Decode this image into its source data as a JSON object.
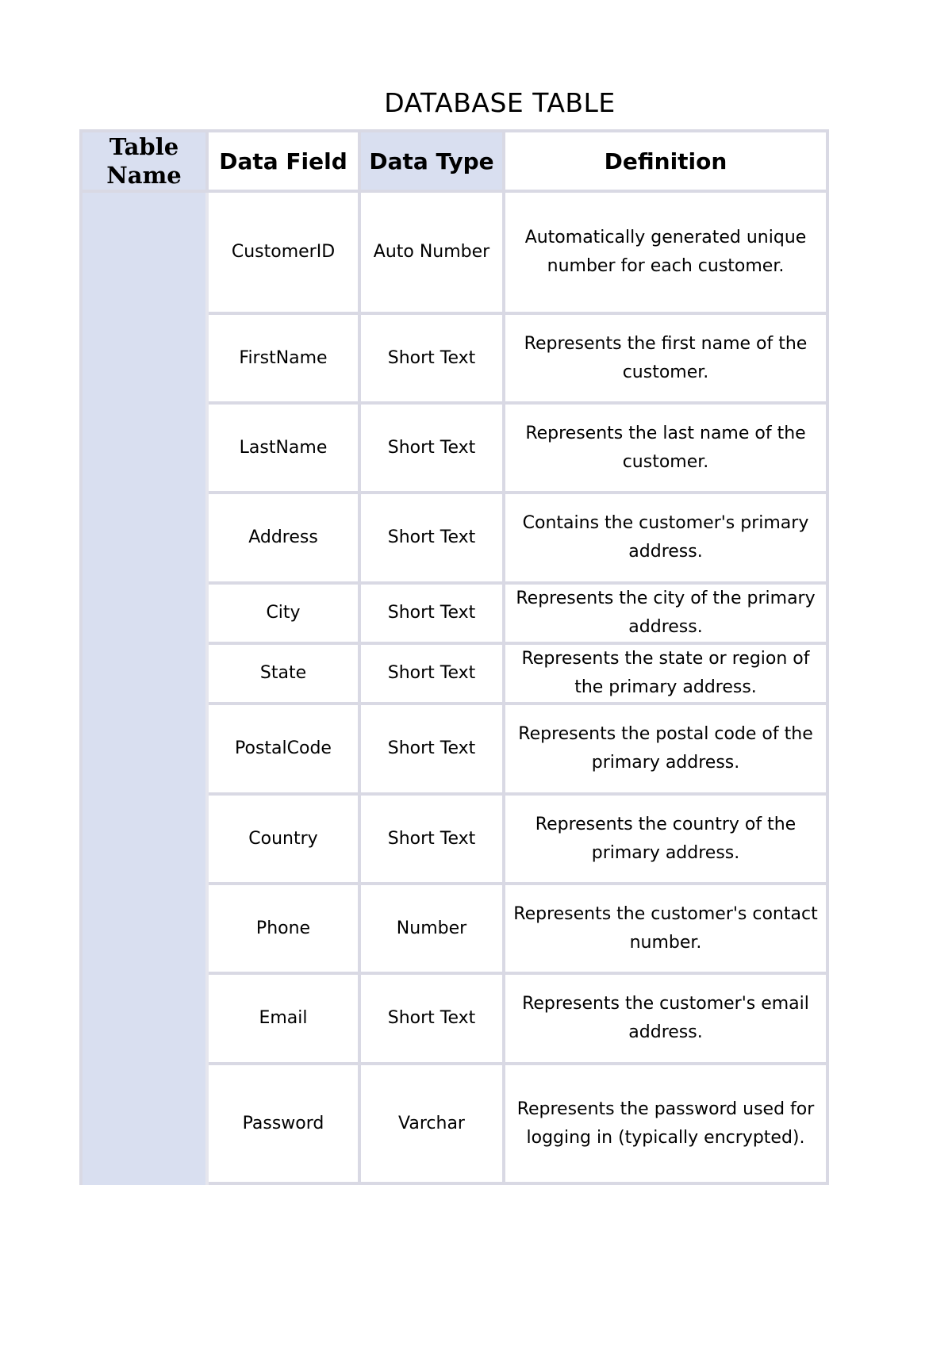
{
  "document": {
    "title": "DATABASE TABLE"
  },
  "table": {
    "headers": {
      "table_name": "Table Name",
      "data_field": "Data Field",
      "data_type": "Data Type",
      "definition": "Definition"
    },
    "table_name_value": "",
    "rows": [
      {
        "field": "CustomerID",
        "type": "Auto Number",
        "definition": "Automatically generated unique number for each customer."
      },
      {
        "field": "FirstName",
        "type": "Short Text",
        "definition": "Represents the first name of the customer."
      },
      {
        "field": "LastName",
        "type": "Short Text",
        "definition": "Represents the last name of the customer."
      },
      {
        "field": "Address",
        "type": "Short Text",
        "definition": "Contains the customer's primary address."
      },
      {
        "field": "City",
        "type": "Short Text",
        "definition": "Represents the city of the primary address."
      },
      {
        "field": "State",
        "type": "Short Text",
        "definition": "Represents the state or region of the primary address."
      },
      {
        "field": "PostalCode",
        "type": "Short Text",
        "definition": "Represents the postal code of the primary address."
      },
      {
        "field": "Country",
        "type": "Short Text",
        "definition": "Represents the country of the primary address."
      },
      {
        "field": "Phone",
        "type": "Number",
        "definition": "Represents the customer's contact number."
      },
      {
        "field": "Email",
        "type": "Short Text",
        "definition": "Represents the customer's email address."
      },
      {
        "field": "Password",
        "type": "Varchar",
        "definition": "Represents the password used for logging in (typically encrypted)."
      }
    ]
  },
  "colors": {
    "header_shade": "#d9dff0",
    "border": "#d9d9e4"
  }
}
